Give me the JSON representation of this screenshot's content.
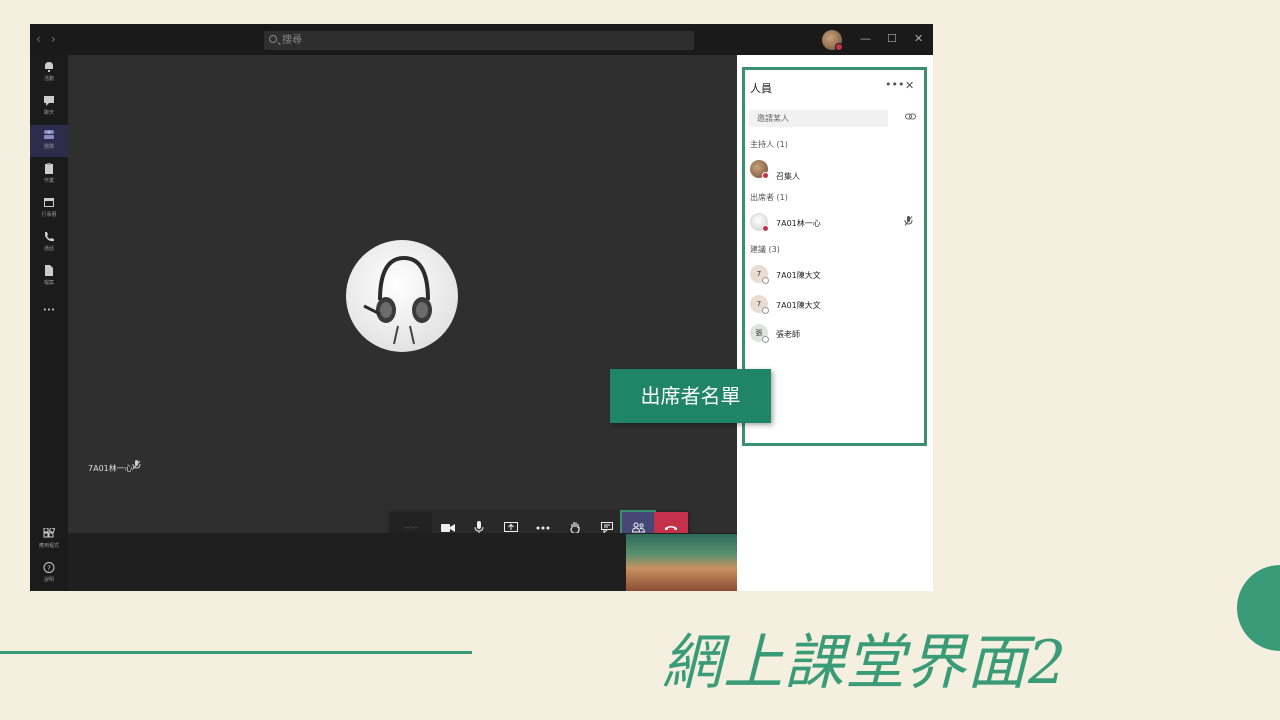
{
  "titlebar": {
    "search_placeholder": "搜尋",
    "nav_back": "‹",
    "nav_forward": "›",
    "minimize": "—",
    "maximize": "☐",
    "close": "✕"
  },
  "rail": {
    "items": [
      {
        "label": "活動",
        "icon": "bell-icon"
      },
      {
        "label": "聊天",
        "icon": "chat-icon"
      },
      {
        "label": "團隊",
        "icon": "teams-icon"
      },
      {
        "label": "作業",
        "icon": "assignments-icon"
      },
      {
        "label": "行事曆",
        "icon": "calendar-icon"
      },
      {
        "label": "通話",
        "icon": "phone-icon"
      },
      {
        "label": "檔案",
        "icon": "files-icon"
      },
      {
        "label": "•••",
        "icon": "more-icon"
      }
    ],
    "apps_label": "應用程式",
    "help_label": "說明"
  },
  "stage": {
    "participant_name": "7A01林一心"
  },
  "callbar": {
    "timer": "--:--"
  },
  "people_panel": {
    "title": "人員",
    "invite_placeholder": "邀請某人",
    "sections": {
      "organizer": "主持人 (1)",
      "attendees": "出席者 (1)",
      "suggested": "建議 (3)"
    },
    "organizer": {
      "name": "召集人"
    },
    "attendee": {
      "name": "7A01林一心"
    },
    "suggested": [
      {
        "initial": "7",
        "name": "7A01陳大文"
      },
      {
        "initial": "7",
        "name": "7A01陳大文"
      },
      {
        "initial": "張",
        "name": "張老師"
      }
    ]
  },
  "callout": {
    "text": "出席者名單"
  },
  "slide": {
    "title": "網上課堂界面2"
  },
  "colors": {
    "accent": "#3a9b78",
    "hangup": "#c4314b",
    "teams_purple": "#464775"
  }
}
